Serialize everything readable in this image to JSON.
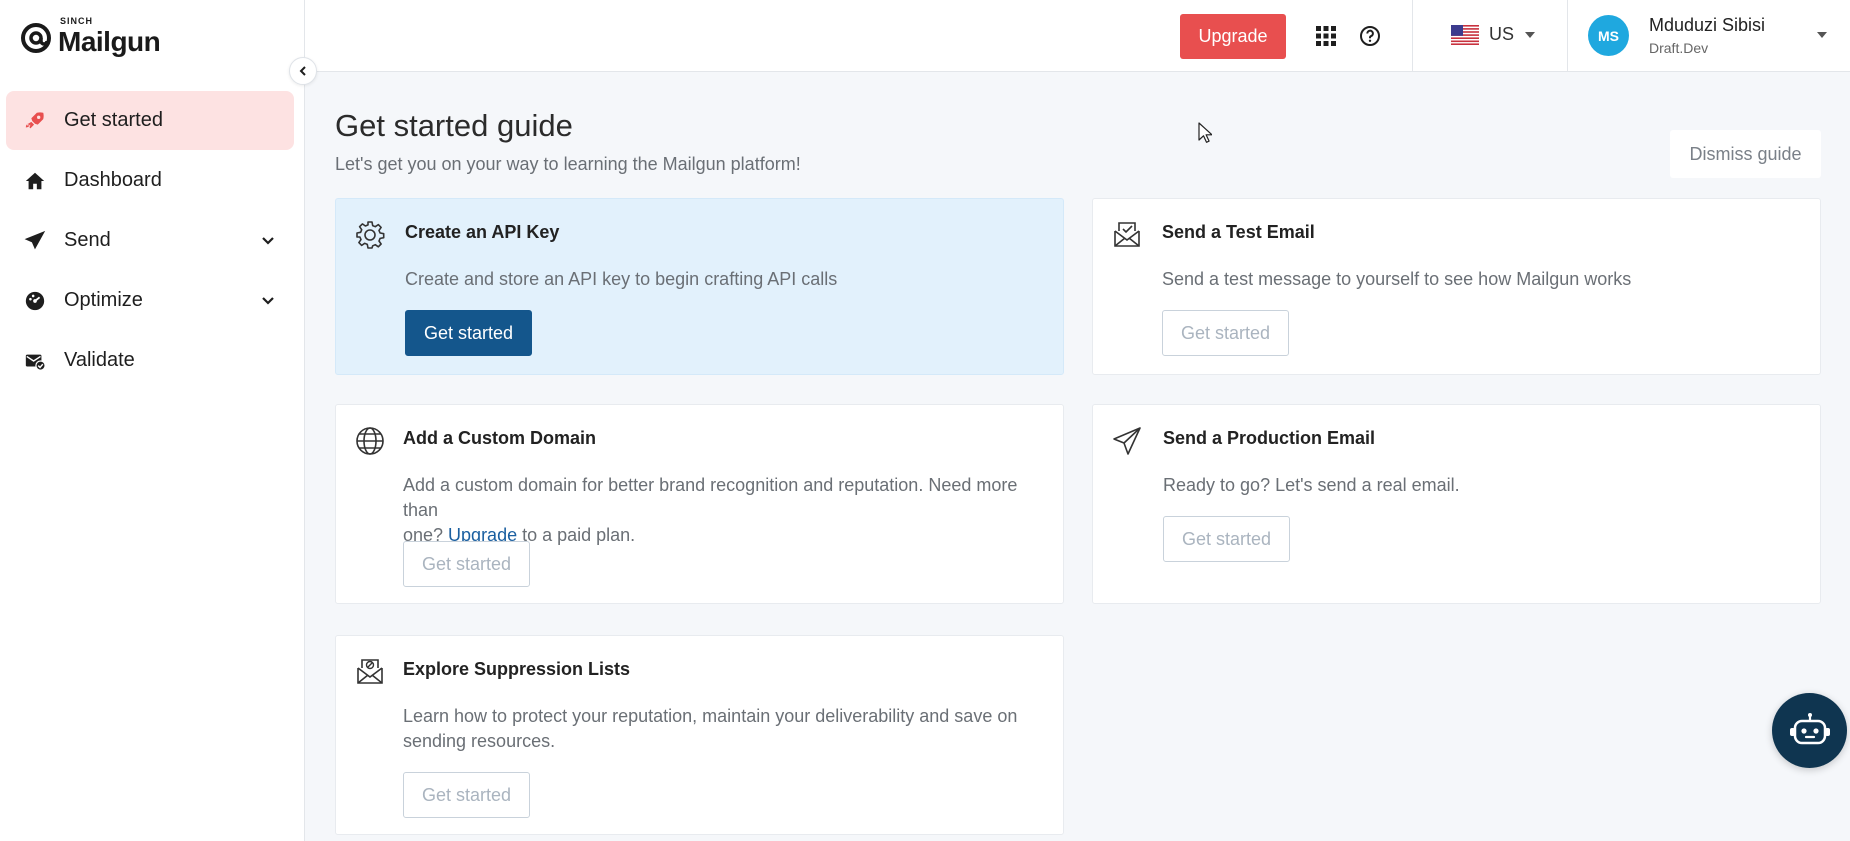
{
  "brand": {
    "sinch": "SINCH",
    "name": "Mailgun"
  },
  "sidebar": {
    "items": [
      {
        "label": "Get started",
        "icon": "rocket-icon",
        "active": true
      },
      {
        "label": "Dashboard",
        "icon": "home-icon"
      },
      {
        "label": "Send",
        "icon": "paper-plane-icon",
        "expandable": true
      },
      {
        "label": "Optimize",
        "icon": "gauge-icon",
        "expandable": true
      },
      {
        "label": "Validate",
        "icon": "validate-icon"
      }
    ]
  },
  "topbar": {
    "upgrade_label": "Upgrade",
    "region": "US",
    "user": {
      "initials": "MS",
      "name": "Mduduzi Sibisi",
      "org": "Draft.Dev"
    }
  },
  "guide": {
    "title": "Get started guide",
    "subtitle": "Let's get you on your way to learning the Mailgun platform!",
    "dismiss_label": "Dismiss guide",
    "cards": {
      "api_key": {
        "title": "Create an API Key",
        "desc": "Create and store an API key to begin crafting API calls",
        "button": "Get started"
      },
      "test_email": {
        "title": "Send a Test Email",
        "desc": "Send a test message to yourself to see how Mailgun works",
        "button": "Get started"
      },
      "custom_domain": {
        "title": "Add a Custom Domain",
        "desc_line1": "Add a custom domain for better brand recognition and reputation. Need more than",
        "desc_pre": "one? ",
        "desc_link": "Upgrade",
        "desc_post": " to a paid plan.",
        "button": "Get started"
      },
      "production_email": {
        "title": "Send a Production Email",
        "desc": "Ready to go? Let's send a real email.",
        "button": "Get started"
      },
      "suppression": {
        "title": "Explore Suppression Lists",
        "desc_line1": "Learn how to protect your reputation, maintain your deliverability and save on",
        "desc_line2": "sending resources.",
        "button": "Get started"
      }
    }
  },
  "colors": {
    "accent": "#e84f4f",
    "primary": "#14568c",
    "highlight": "#e2f1fc",
    "avatar": "#1fa8df"
  }
}
